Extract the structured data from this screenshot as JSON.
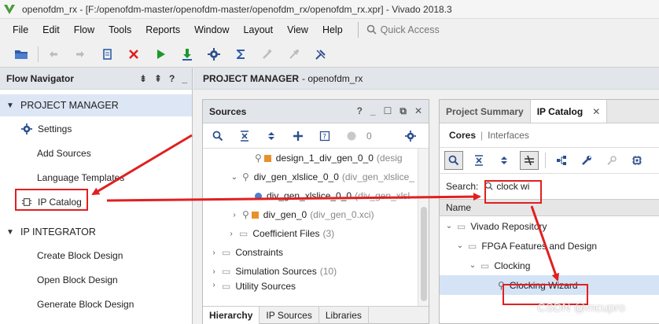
{
  "window": {
    "title": "openofdm_rx - [F:/openofdm-master/openofdm-master/openofdm_rx/openofdm_rx.xpr] - Vivado 2018.3"
  },
  "menu": {
    "items": [
      "File",
      "Edit",
      "Flow",
      "Tools",
      "Reports",
      "Window",
      "Layout",
      "View",
      "Help"
    ],
    "quick_access_placeholder": "Quick Access"
  },
  "toolbar": {
    "icons": [
      "open-project",
      "undo",
      "redo",
      "copy",
      "stop",
      "run",
      "download",
      "settings",
      "sum",
      "auto-connect",
      "debug",
      "unplug"
    ]
  },
  "flow_navigator": {
    "title": "Flow Navigator",
    "sections": [
      {
        "label": "PROJECT MANAGER",
        "items": [
          "Settings",
          "Add Sources",
          "Language Templates",
          "IP Catalog"
        ]
      },
      {
        "label": "IP INTEGRATOR",
        "items": [
          "Create Block Design",
          "Open Block Design",
          "Generate Block Design"
        ]
      }
    ]
  },
  "project_manager": {
    "label": "PROJECT MANAGER",
    "project": "openofdm_rx"
  },
  "sources": {
    "title": "Sources",
    "count": "0",
    "rows": [
      {
        "name": "design_1_div_gen_0_0",
        "detail": "(desig"
      },
      {
        "name": "div_gen_xlslice_0_0",
        "detail": "(div_gen_xlslice_"
      },
      {
        "name": "div_gen_xlslice_0_0",
        "detail": "(div_gen_xlsl"
      },
      {
        "name": "div_gen_0",
        "detail": "(div_gen_0.xci)"
      },
      {
        "name": "Coefficient Files",
        "detail": "(3)"
      },
      {
        "name": "Constraints",
        "detail": ""
      },
      {
        "name": "Simulation Sources",
        "detail": "(10)"
      },
      {
        "name": "Utility Sources",
        "detail": ""
      }
    ],
    "tabs": [
      "Hierarchy",
      "IP Sources",
      "Libraries"
    ]
  },
  "ip_catalog": {
    "tabs": [
      "Project Summary",
      "IP Catalog"
    ],
    "subtabs": [
      "Cores",
      "Interfaces"
    ],
    "search_label": "Search:",
    "search_value": "clock wi",
    "column": "Name",
    "tree": [
      {
        "label": "Vivado Repository",
        "level": 0
      },
      {
        "label": "FPGA Features and Design",
        "level": 1
      },
      {
        "label": "Clocking",
        "level": 2
      },
      {
        "label": "Clocking Wizard",
        "level": 3
      }
    ]
  },
  "watermark": "CSDN @mcupro",
  "colors": {
    "accent": "#e02020",
    "header_bg": "#e2e5ea",
    "selection": "#d5e3f6"
  }
}
